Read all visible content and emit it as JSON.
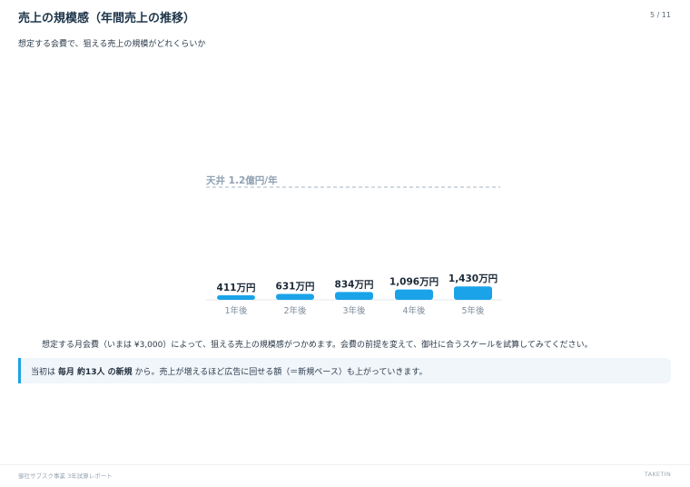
{
  "header": {
    "title": "売上の規模感（年間売上の推移）",
    "page_indicator": "5 / 11"
  },
  "subtitle": "想定する会費で、狙える売上の規模がどれくらいか",
  "chart_data": {
    "type": "bar",
    "categories": [
      "1年後",
      "2年後",
      "3年後",
      "4年後",
      "5年後"
    ],
    "values": [
      411,
      631,
      834,
      1096,
      1430
    ],
    "value_labels": [
      "411万円",
      "631万円",
      "834万円",
      "1,096万円",
      "1,430万円"
    ],
    "unit": "万円",
    "reference_line": {
      "label": "天井 1.2億円/年",
      "value": 12000
    },
    "ylim": [
      0,
      12000
    ],
    "bar_color": "#1aa3e8"
  },
  "description": "想定する月会費（いまは ¥3,000）によって、狙える売上の規模感がつかめます。会費の前提を変えて、御社に合うスケールを試算してみてください。",
  "note": {
    "prefix": "当初は ",
    "highlight": "毎月 約13人 の新規",
    "suffix": " から。売上が増えるほど広告に回せる額（＝新規ペース）も上がっていきます。",
    "accent_color": "#1aa3e8"
  },
  "footer": {
    "left": "御社サブスク事業 3年試算レポート",
    "right": "TAKETIN"
  }
}
